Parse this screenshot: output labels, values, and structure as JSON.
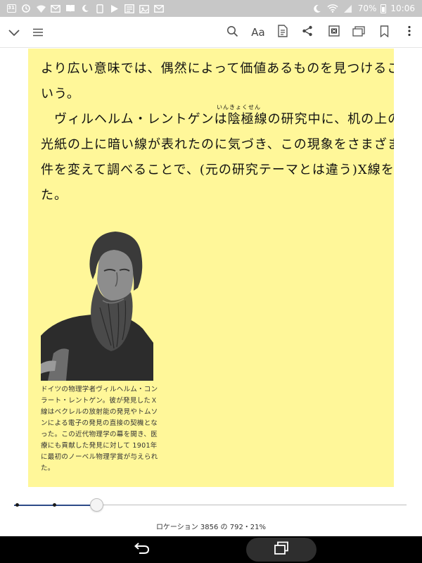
{
  "status_bar": {
    "calendar_badge": "31",
    "battery_percent": "70%",
    "clock": "10:06",
    "icons": [
      "calendar-icon",
      "sync-icon",
      "wifi-question-icon",
      "mail-icon",
      "book-icon",
      "moon-icon",
      "phone-icon",
      "play-store-icon",
      "tasks-icon",
      "photo-icon",
      "mail-icon"
    ]
  },
  "toolbar": {
    "font_button": "Aa",
    "icons": [
      "chevron-down-icon",
      "menu-icon",
      "search-icon",
      "font-icon",
      "notes-icon",
      "share-icon",
      "xray-icon",
      "flashcards-icon",
      "bookmark-icon",
      "more-icon"
    ]
  },
  "content": {
    "lines": [
      "より広い意味では、偶然によって価値あるものを見つけることを",
      "いう。",
      "　ヴィルヘルム・レントゲンは陰極線の研究中に、机の上の蛍",
      "光紙の上に暗い線が表れたのに気づき、この現象をさまざまに条",
      "件を変えて調べることで、(元の研究テーマとは違う)X線を発見し",
      "た。"
    ],
    "ruby": "いんきょくせん",
    "caption": "ドイツの物理学者ヴィルヘルム・コンラート・レントゲン。彼が発見したＸ線はベクレルの放射能の発見やトムソンによる電子の発見の直接の契機となった。この近代物理学の幕を開き、医療にも貢献した発見に対して 1901年に最初のノーベル物理学賞が与えられた。",
    "highlight_color": "#fff799"
  },
  "progress": {
    "percent": 21,
    "location_text": "ロケーション 3856 の 792・21%",
    "accent_color": "#2d4a88"
  },
  "nav_bar": {
    "icons": [
      "back-icon",
      "recent-apps-icon"
    ]
  }
}
